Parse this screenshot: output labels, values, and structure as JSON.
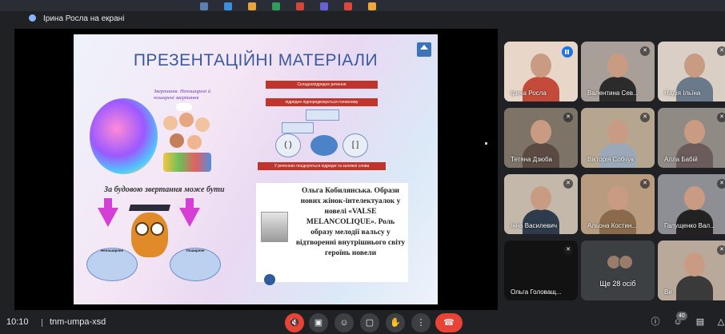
{
  "presenter_label": "Ірина Росла на екрані",
  "slide": {
    "title": "ПРЕЗЕНТАЦІЙНІ МАТЕРІАЛИ",
    "kids_caption": "Звертання. Непоширені й поширені звертання",
    "scheme_top": "Складнопідрядне речення",
    "scheme_mid": "підрядне підпорядковується головному",
    "scheme_bottom": "У реченнях поєднуються підрядні та залежні слова",
    "scheme_left": "( )",
    "scheme_right": "[ ]",
    "owl_header": "За будовою звертання може бути",
    "owl_left": "Непоширене",
    "owl_right": "Поширене",
    "book_text": "Ольга Кобилянська. Образи нових жінок-інтелектуалок у новелі «VALSE MELANCOLIQUE». Роль образу мелодії вальсу у відтворенні внутрішнього світу героїнь новели"
  },
  "participants": [
    {
      "name": "Ірина Росла",
      "active": true,
      "muted": false,
      "bg": "#e8d6c8",
      "shirt": "#c44b3a"
    },
    {
      "name": "Валентина Сев...",
      "active": false,
      "muted": true,
      "bg": "#a8a098",
      "shirt": "#2b2b2b"
    },
    {
      "name": "Надія Ільїна",
      "active": false,
      "muted": true,
      "bg": "#d9cfc4",
      "shirt": "#6b7a8a"
    },
    {
      "name": "Тетяна Дзюба",
      "active": false,
      "muted": true,
      "bg": "#7d7366",
      "shirt": "#5a4a42"
    },
    {
      "name": "Вікторія Собчук",
      "active": false,
      "muted": true,
      "bg": "#b7a68f",
      "shirt": "#9aa8b8"
    },
    {
      "name": "Алла Бабій",
      "active": false,
      "muted": true,
      "bg": "#8f8a84",
      "shirt": "#6b5b5b"
    },
    {
      "name": "Інна Василевич",
      "active": false,
      "muted": true,
      "bg": "#c4b8aa",
      "shirt": "#2d3b4d"
    },
    {
      "name": "Альона Костин...",
      "active": false,
      "muted": true,
      "bg": "#b99c80",
      "shirt": "#8a6a4a"
    },
    {
      "name": "Галущенко Вал...",
      "active": false,
      "muted": true,
      "bg": "#8d8f95",
      "shirt": "#222"
    },
    {
      "name": "Ольга Головащ...",
      "active": false,
      "muted": true,
      "bg": "#121212",
      "shirt": "#121212"
    },
    {
      "name": "Ще 28 осіб",
      "more": true
    },
    {
      "name": "Ви",
      "active": false,
      "muted": true,
      "bg": "#b8a99b",
      "shirt": "#3a3a3a"
    }
  ],
  "bottom": {
    "time": "10:10",
    "meeting_code": "tnm-umpa-xsd",
    "participant_count": "40"
  }
}
